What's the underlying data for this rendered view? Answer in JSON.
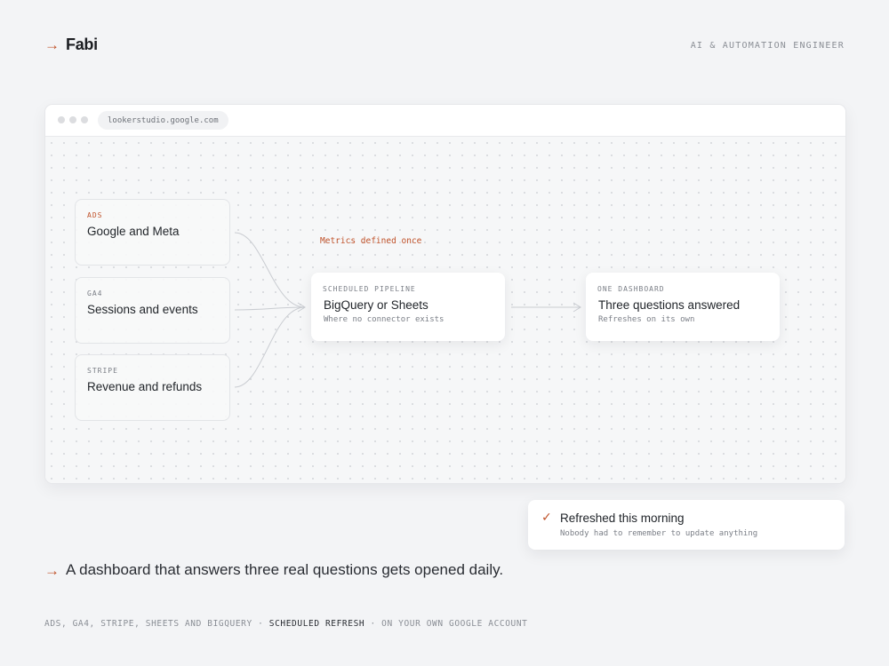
{
  "header": {
    "arrow": "→",
    "brand": "Fabi",
    "role": "AI & AUTOMATION ENGINEER"
  },
  "window": {
    "url": "lookerstudio.google.com"
  },
  "sources": [
    {
      "tag": "ADS",
      "title": "Google and Meta"
    },
    {
      "tag": "GA4",
      "title": "Sessions and events"
    },
    {
      "tag": "STRIPE",
      "title": "Revenue and refunds"
    }
  ],
  "metrics_note": "Metrics defined once",
  "pipeline": {
    "tag": "SCHEDULED PIPELINE",
    "title": "BigQuery or Sheets",
    "subtitle": "Where no connector exists"
  },
  "dashboard": {
    "tag": "ONE DASHBOARD",
    "title": "Three questions answered",
    "subtitle": "Refreshes on its own"
  },
  "toast": {
    "check": "✓",
    "title": "Refreshed this morning",
    "subtitle": "Nobody had to remember to update anything"
  },
  "tagline": {
    "arrow": "→",
    "text": "A dashboard that answers three real questions gets opened daily."
  },
  "footer": {
    "part1": "ADS, GA4, STRIPE, SHEETS AND BIGQUERY · ",
    "part2": "SCHEDULED REFRESH",
    "part3": " · ON YOUR OWN GOOGLE ACCOUNT"
  },
  "colors": {
    "accent": "#c0522a",
    "background": "#f3f4f6",
    "card": "#ffffff",
    "muted_text": "#8a8e95"
  }
}
